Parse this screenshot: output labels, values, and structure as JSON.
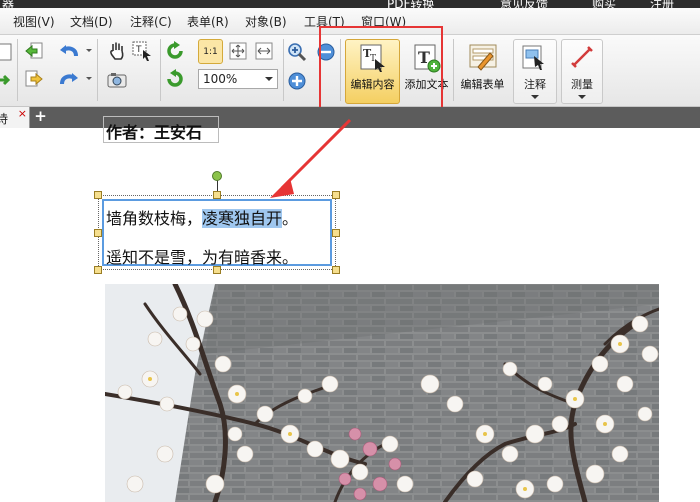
{
  "title_bar": {
    "left_text": "器",
    "pdf_convert": "PDF转换",
    "feedback": "意见反馈",
    "buy": "购买",
    "register": "注册"
  },
  "menu": [
    "视图(V)",
    "文档(D)",
    "注释(C)",
    "表单(R)",
    "对象(B)",
    "工具(T)",
    "窗口(W)"
  ],
  "toolbar": {
    "zoom_value": "100%",
    "actual_size_label": "1:1",
    "edit_content_label": "编辑内容",
    "add_text_label": "添加文本",
    "edit_form_label": "编辑表单",
    "annotate_label": "注释",
    "measure_label": "测量"
  },
  "tabs": {
    "doc_tab_label": "诗",
    "close_glyph": "×",
    "new_tab_glyph": "+"
  },
  "document": {
    "author_line": "作者：王安石",
    "line1_plain": "墙角数枝梅，",
    "line1_selected": "凌寒独自开",
    "line1_end": "。",
    "line2": "遥知不是雪，为有暗香来。"
  },
  "colors": {
    "highlight": "#e63535",
    "selection": "#9fc7ef",
    "arrow": "#e63535",
    "tab_bar": "#5c5c5c"
  }
}
